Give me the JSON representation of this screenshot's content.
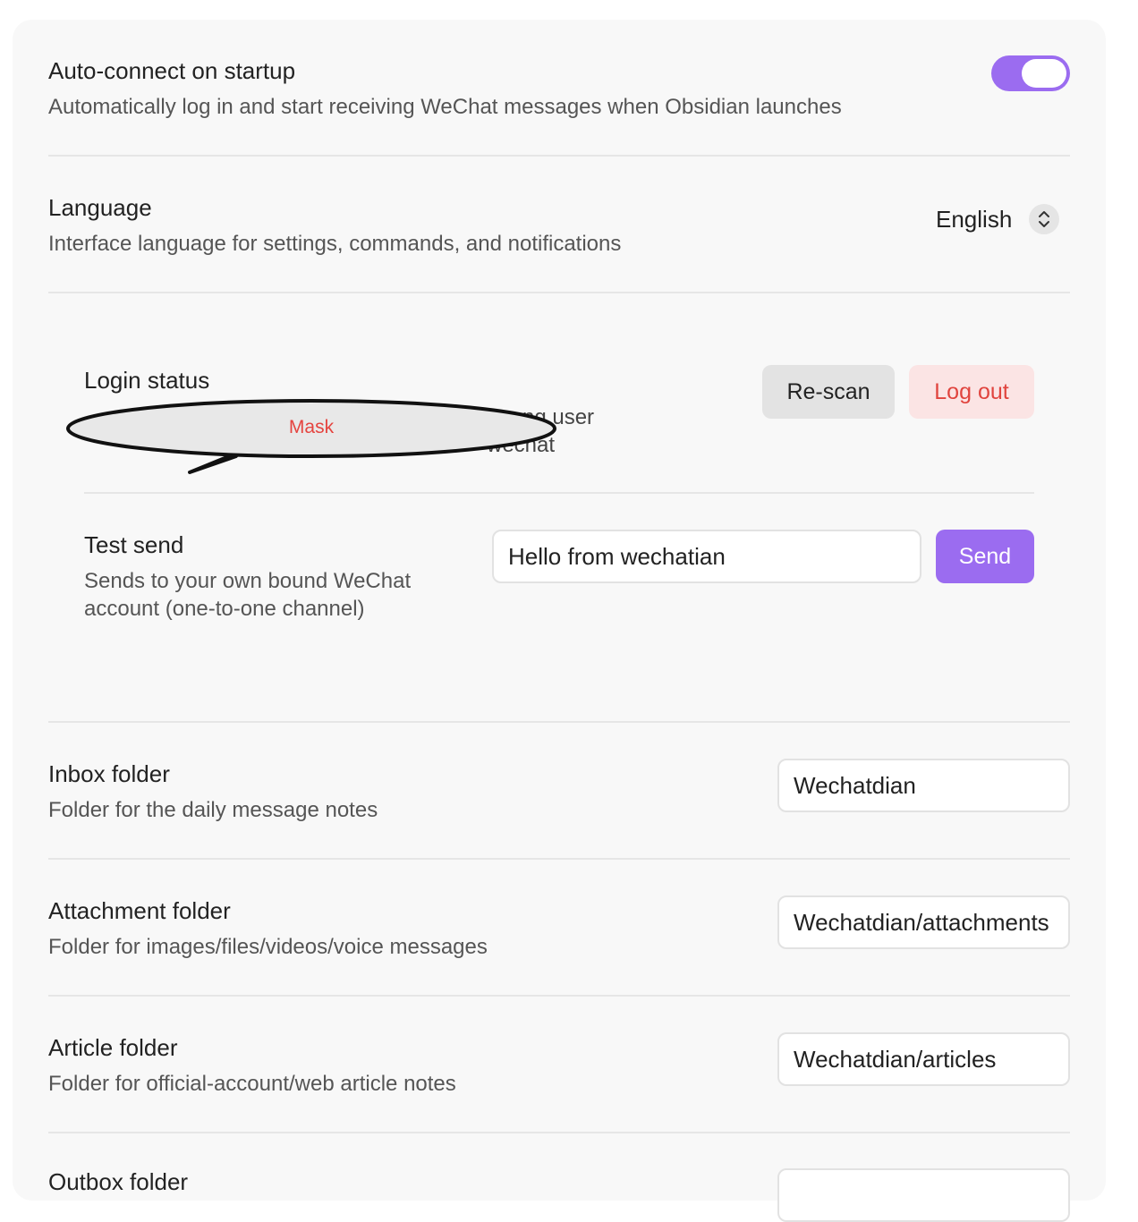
{
  "auto_connect": {
    "title": "Auto-connect on startup",
    "description": "Automatically log in and start receiving WeChat messages when Obsidian launches",
    "enabled": true
  },
  "language": {
    "title": "Language",
    "description": "Interface language for settings, commands, and notifications",
    "selected": "English"
  },
  "login": {
    "title": "Login status",
    "partial_text_line1": "ng user",
    "partial_text_line2": "wechat",
    "mask_label": "Mask",
    "rescan_label": "Re-scan",
    "logout_label": "Log out"
  },
  "test_send": {
    "title": "Test send",
    "description": "Sends to your own bound WeChat account (one-to-one channel)",
    "input_value": "Hello from wechatian",
    "send_label": "Send"
  },
  "inbox": {
    "title": "Inbox folder",
    "description": "Folder for the daily message notes",
    "value": "Wechatdian"
  },
  "attachment": {
    "title": "Attachment folder",
    "description": "Folder for images/files/videos/voice messages",
    "value": "Wechatdian/attachments"
  },
  "article": {
    "title": "Article folder",
    "description": "Folder for official-account/web article notes",
    "value": "Wechatdian/articles"
  },
  "outbox": {
    "title": "Outbox folder"
  },
  "colors": {
    "accent": "#9b6cf0",
    "danger": "#e0443e",
    "danger_bg": "#fbe4e4",
    "panel_bg": "#f8f8f8"
  }
}
